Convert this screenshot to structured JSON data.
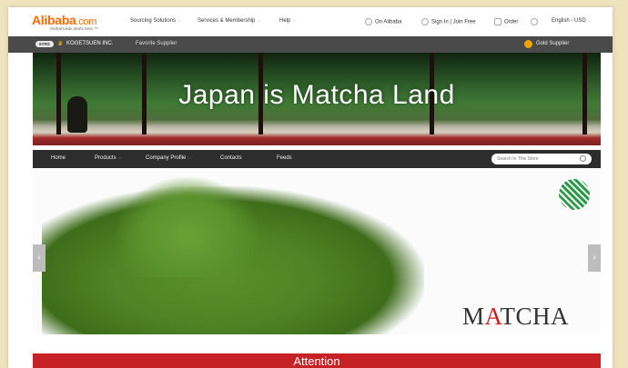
{
  "header": {
    "logo_text": "Alibaba",
    "logo_suffix": ".com",
    "logo_tagline": "Global trade starts here.™",
    "nav": [
      {
        "label": "Sourcing Solutions"
      },
      {
        "label": "Services & Membership"
      },
      {
        "label": "Help"
      }
    ],
    "on_alibaba": "On Alibaba",
    "sign_in": "Sign In",
    "join_free": "Join Free",
    "order": "Order",
    "language": "English - USD"
  },
  "store_bar": {
    "years_badge": "6YRS",
    "store_name": "KOGETSUEN INC.",
    "favorite": "Favorite Supplier",
    "gold": "Gold Supplier"
  },
  "banner": {
    "title": "Japan is Matcha Land"
  },
  "store_nav": {
    "items": [
      {
        "label": "Home"
      },
      {
        "label": "Products"
      },
      {
        "label": "Company Profile"
      },
      {
        "label": "Contacts"
      },
      {
        "label": "Feeds"
      }
    ],
    "search_placeholder": "Search In This Store"
  },
  "hero": {
    "brand_text_a": "M",
    "brand_text_b": "A",
    "brand_text_c": "TCHA",
    "prev": "‹",
    "next": "›"
  },
  "attention": {
    "label": "Attention"
  },
  "colors": {
    "brand_orange": "#ff6a00",
    "nav_dark": "#2d2d2d",
    "attention_red": "#c62125",
    "matcha_green": "#4f8324"
  }
}
